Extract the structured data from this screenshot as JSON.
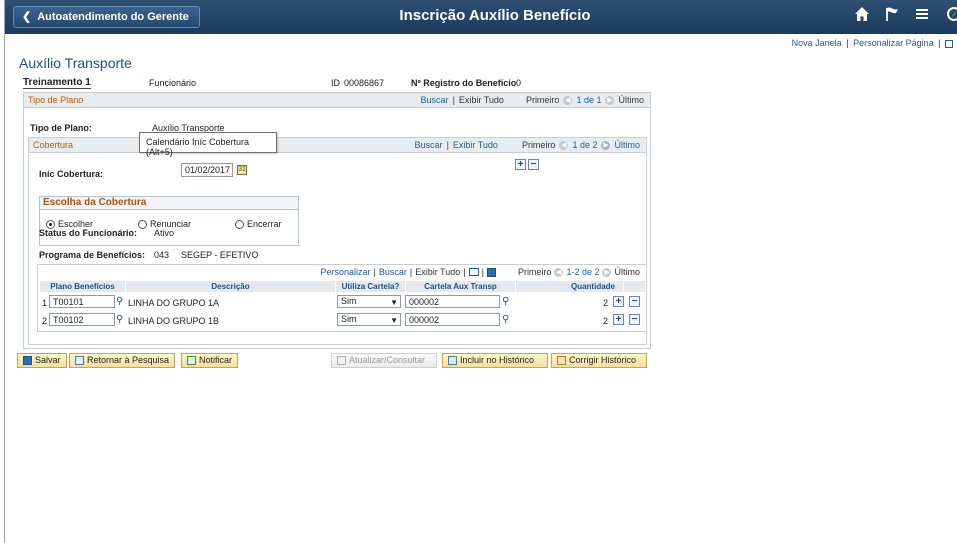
{
  "header": {
    "back_label": "Autoatendimento do Gerente",
    "title": "Inscrição Auxílio Benefício"
  },
  "util_links": {
    "new_window": "Nova Janela",
    "personalize_page": "Personalizar Página",
    "sep": "|"
  },
  "component_title": "Auxílio Transporte",
  "employee": {
    "name": "Treinamento 1",
    "role": "Funcionário",
    "id_label": "ID",
    "id_value": "00086867",
    "reg_label": "Nº Registro do Benefício",
    "reg_value": "0"
  },
  "plan_box": {
    "caption": "Tipo de Plano",
    "find": "Buscar",
    "view_all": "Exibir Tudo",
    "first": "Primeiro",
    "counter": "1 de 1",
    "last": "Último",
    "plan_type_label": "Tipo de Plano:",
    "plan_type_value": "Auxílio Transporte"
  },
  "tooltip": "Calendário Iníc Cobertura (Alt+5)",
  "coverage_box": {
    "caption": "Cobertura",
    "find": "Buscar",
    "view_all": "Exibir Tudo",
    "first": "Primeiro",
    "counter": "1 de 2",
    "last": "Último",
    "start_label": "Iníc Cobertura:",
    "start_value": "01/02/2017",
    "choice_title": "Escolha da Cobertura",
    "options": [
      "Escolher",
      "Renunciar",
      "Encerrar"
    ],
    "selected": "Escolher",
    "status_label": "Status do Funcionário:",
    "status_value": "Ativo",
    "program_label": "Programa de Benefícios:",
    "program_code": "043",
    "program_name": "SEGEP - EFETIVO"
  },
  "grid": {
    "personalize": "Personalizar",
    "find": "Buscar",
    "view_all": "Exibir Tudo",
    "first": "Primeiro",
    "counter": "1-2 de 2",
    "last": "Último",
    "columns": [
      "Plano Benefícios",
      "Descrição",
      "Utiliza Cartela?",
      "Cartela Aux Transp",
      "Quantidade"
    ],
    "rows": [
      {
        "num": "1",
        "plan": "T00101",
        "desc": "LINHA DO GRUPO 1A",
        "uses_card": "Sim",
        "card": "000002",
        "qty": "2"
      },
      {
        "num": "2",
        "plan": "T00102",
        "desc": "LINHA DO GRUPO 1B",
        "uses_card": "Sim",
        "card": "000002",
        "qty": "2"
      }
    ]
  },
  "buttons": {
    "save": "Salvar",
    "return_search": "Retornar à Pesquisa",
    "notify": "Notificar",
    "update_display": "Atualizar/Consultar",
    "include_history": "Incluir no Histórico",
    "correct_history": "Corrigir Histórico"
  },
  "colors": {
    "topbar": "#1b3a5c",
    "link": "#1d5ea0",
    "caption": "#b85a12",
    "title": "#1d4f84"
  }
}
